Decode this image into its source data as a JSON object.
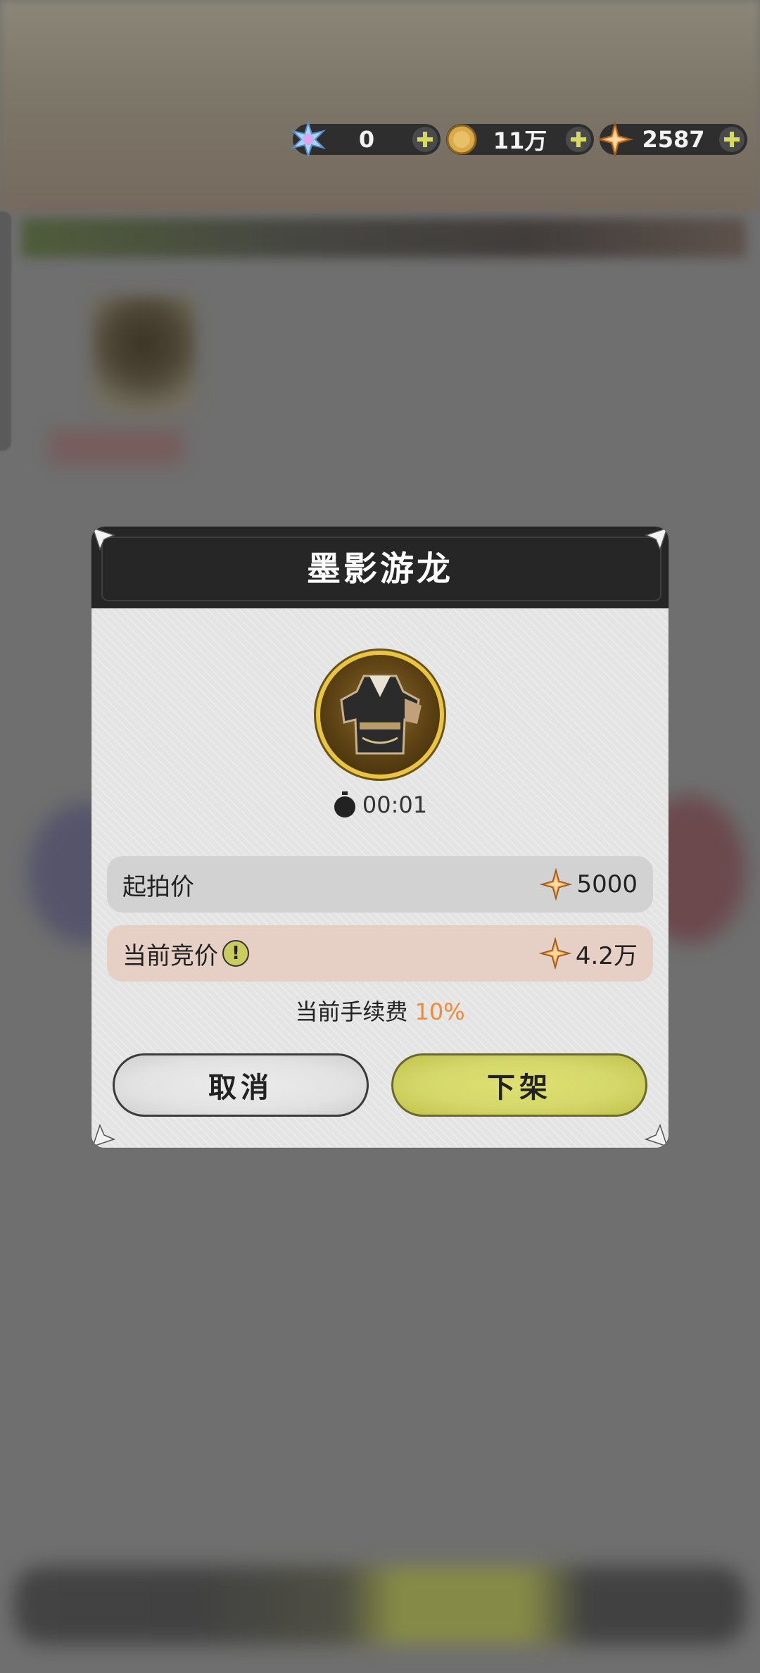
{
  "currency": {
    "gems": {
      "icon": "snowflake-gem-icon",
      "value": "0"
    },
    "coins": {
      "icon": "gold-coin-icon",
      "value": "11万"
    },
    "stars": {
      "icon": "orange-star-crystal-icon",
      "value": "2587"
    }
  },
  "dialog": {
    "title": "墨影游龙",
    "item_icon": "armor-item-icon",
    "timer": "00:01",
    "start_price": {
      "label": "起拍价",
      "value": "5000",
      "icon": "orange-star-crystal-icon"
    },
    "current_bid": {
      "label": "当前竞价",
      "value": "4.2万",
      "icon": "orange-star-crystal-icon"
    },
    "fee": {
      "label": "当前手续费",
      "value": "10%"
    },
    "buttons": {
      "cancel": "取消",
      "delist": "下架"
    }
  },
  "colors": {
    "accent_yellow": "#d4d86a",
    "fee_orange": "#f08a3a",
    "header_dark": "#262626"
  }
}
